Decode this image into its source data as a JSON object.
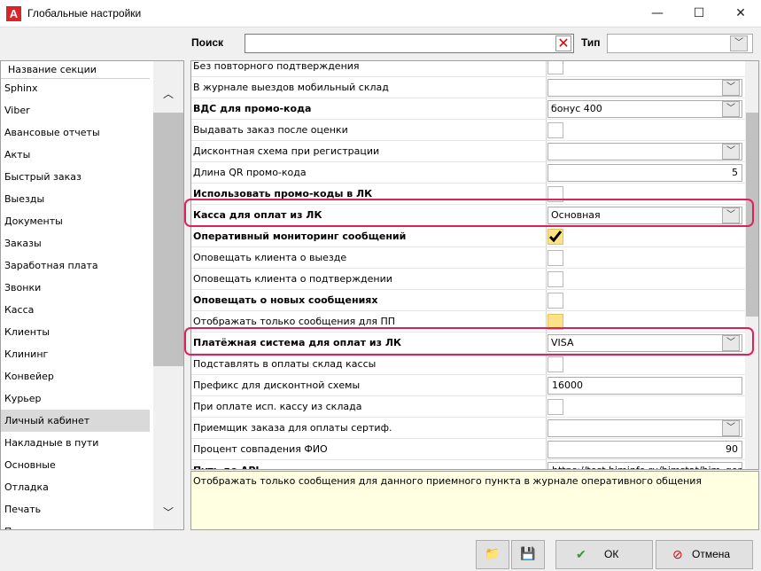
{
  "window": {
    "title": "Глобальные настройки",
    "minimize": "—",
    "maximize": "☐",
    "close": "✕",
    "app_icon_letter": "A"
  },
  "search": {
    "label": "Поиск",
    "value": "",
    "clear_icon": "✕",
    "type_label": "Тип",
    "type_value": "",
    "dropdown_icon": "﹀"
  },
  "sections": {
    "header": "Название секции",
    "items": [
      "Sphinx",
      "Viber",
      "Авансовые отчеты",
      "Акты",
      "Быстрый заказ",
      "Выезды",
      "Документы",
      "Заказы",
      "Заработная плата",
      "Звонки",
      "Касса",
      "Клиенты",
      "Клининг",
      "Конвейер",
      "Курьер",
      "Личный кабинет",
      "Накладные в пути",
      "Основные",
      "Отладка",
      "Печать",
      "Прочие"
    ],
    "selected": "Личный кабинет",
    "scroll_up": "︿",
    "scroll_down": "﹀"
  },
  "settings": [
    {
      "name": "Без повторного подтверждения",
      "bold": false,
      "kind": "checkbox",
      "value": ""
    },
    {
      "name": "В журнале выездов мобильный склад",
      "bold": false,
      "kind": "select",
      "value": ""
    },
    {
      "name": "ВДС для промо-кода",
      "bold": true,
      "kind": "select",
      "value": "бонус 400"
    },
    {
      "name": "Выдавать заказ после оценки",
      "bold": false,
      "kind": "checkbox",
      "value": ""
    },
    {
      "name": "Дисконтная схема при регистрации",
      "bold": false,
      "kind": "select",
      "value": ""
    },
    {
      "name": "Длина QR промо-кода",
      "bold": false,
      "kind": "number",
      "value": "5"
    },
    {
      "name": "Использовать промо-коды в ЛК",
      "bold": true,
      "kind": "checkbox",
      "value": ""
    },
    {
      "name": "Касса для оплат из ЛК",
      "bold": true,
      "kind": "select",
      "value": "Основная",
      "highlight": true
    },
    {
      "name": "Оперативный мониторинг сообщений",
      "bold": true,
      "kind": "checkbox-checked",
      "value": ""
    },
    {
      "name": "Оповещать клиента о выезде",
      "bold": false,
      "kind": "checkbox",
      "value": ""
    },
    {
      "name": "Оповещать клиента о подтверждении",
      "bold": false,
      "kind": "checkbox",
      "value": ""
    },
    {
      "name": "Оповещать о новых сообщениях",
      "bold": true,
      "kind": "checkbox",
      "value": ""
    },
    {
      "name": "Отображать только сообщения для ПП",
      "bold": false,
      "kind": "checkbox-yellow",
      "value": ""
    },
    {
      "name": "Платёжная система для оплат из ЛК",
      "bold": true,
      "kind": "select",
      "value": "VISA",
      "highlight": true
    },
    {
      "name": "Подставлять в оплаты склад кассы",
      "bold": false,
      "kind": "checkbox",
      "value": ""
    },
    {
      "name": "Префикс для дисконтной схемы",
      "bold": false,
      "kind": "text",
      "value": "16000"
    },
    {
      "name": "При оплате исп. кассу из склада",
      "bold": false,
      "kind": "checkbox",
      "value": ""
    },
    {
      "name": "Приемщик заказа для оплаты сертиф.",
      "bold": false,
      "kind": "select",
      "value": ""
    },
    {
      "name": "Процент совпадения ФИО",
      "bold": false,
      "kind": "number",
      "value": "90"
    },
    {
      "name": "Путь до API",
      "bold": true,
      "kind": "text",
      "value": "https://test.himinfo.ru/himstat/him_general_i"
    }
  ],
  "description": "Отображать только сообщения для данного приемного пункта в журнале оперативного общения",
  "buttons": {
    "folder_icon": "📁",
    "save_icon": "💾",
    "ok_label": "ОК",
    "ok_icon": "✔",
    "cancel_label": "Отмена",
    "cancel_icon": "⊘"
  },
  "colors": {
    "highlight": "#e0205a",
    "selected_row": "#d9d9d9",
    "description_bg": "#ffffe1",
    "checkbox_yellow": "#fde28a"
  }
}
